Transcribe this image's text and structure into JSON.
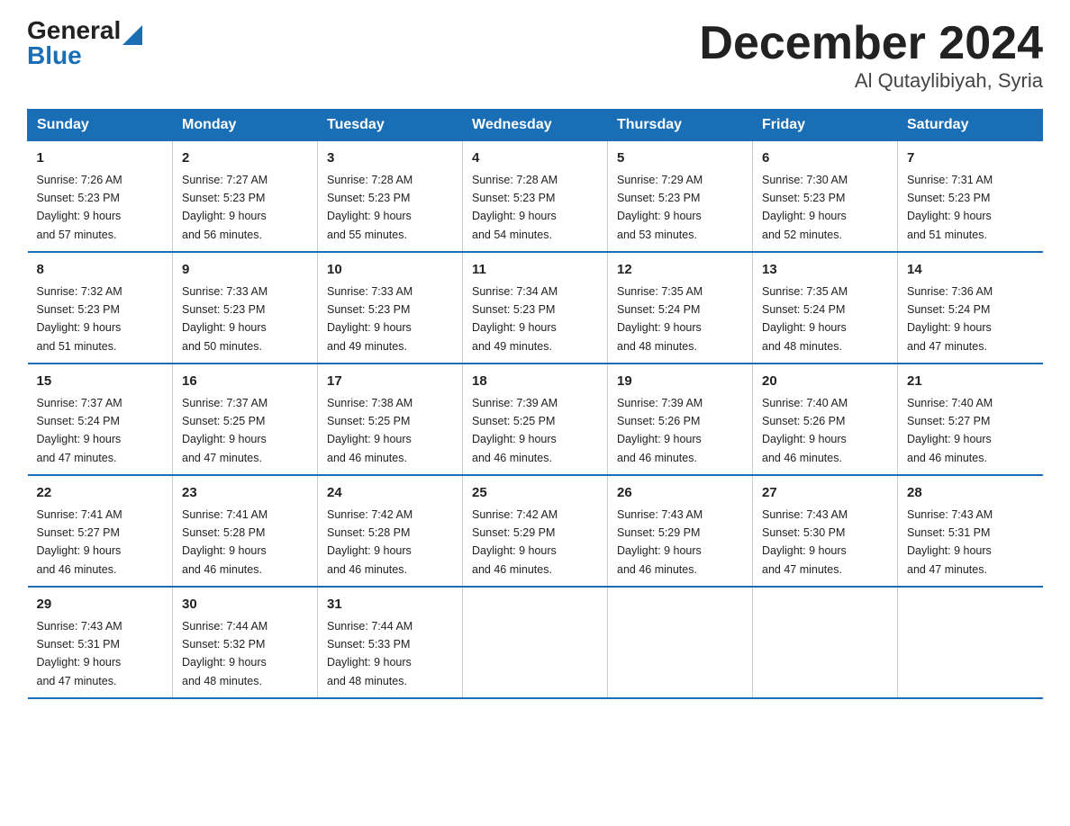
{
  "header": {
    "logo_general": "General",
    "logo_blue": "Blue",
    "month_title": "December 2024",
    "location": "Al Qutaylibiyah, Syria"
  },
  "days_of_week": [
    "Sunday",
    "Monday",
    "Tuesday",
    "Wednesday",
    "Thursday",
    "Friday",
    "Saturday"
  ],
  "weeks": [
    [
      {
        "day": "1",
        "sunrise": "7:26 AM",
        "sunset": "5:23 PM",
        "daylight": "9 hours and 57 minutes."
      },
      {
        "day": "2",
        "sunrise": "7:27 AM",
        "sunset": "5:23 PM",
        "daylight": "9 hours and 56 minutes."
      },
      {
        "day": "3",
        "sunrise": "7:28 AM",
        "sunset": "5:23 PM",
        "daylight": "9 hours and 55 minutes."
      },
      {
        "day": "4",
        "sunrise": "7:28 AM",
        "sunset": "5:23 PM",
        "daylight": "9 hours and 54 minutes."
      },
      {
        "day": "5",
        "sunrise": "7:29 AM",
        "sunset": "5:23 PM",
        "daylight": "9 hours and 53 minutes."
      },
      {
        "day": "6",
        "sunrise": "7:30 AM",
        "sunset": "5:23 PM",
        "daylight": "9 hours and 52 minutes."
      },
      {
        "day": "7",
        "sunrise": "7:31 AM",
        "sunset": "5:23 PM",
        "daylight": "9 hours and 51 minutes."
      }
    ],
    [
      {
        "day": "8",
        "sunrise": "7:32 AM",
        "sunset": "5:23 PM",
        "daylight": "9 hours and 51 minutes."
      },
      {
        "day": "9",
        "sunrise": "7:33 AM",
        "sunset": "5:23 PM",
        "daylight": "9 hours and 50 minutes."
      },
      {
        "day": "10",
        "sunrise": "7:33 AM",
        "sunset": "5:23 PM",
        "daylight": "9 hours and 49 minutes."
      },
      {
        "day": "11",
        "sunrise": "7:34 AM",
        "sunset": "5:23 PM",
        "daylight": "9 hours and 49 minutes."
      },
      {
        "day": "12",
        "sunrise": "7:35 AM",
        "sunset": "5:24 PM",
        "daylight": "9 hours and 48 minutes."
      },
      {
        "day": "13",
        "sunrise": "7:35 AM",
        "sunset": "5:24 PM",
        "daylight": "9 hours and 48 minutes."
      },
      {
        "day": "14",
        "sunrise": "7:36 AM",
        "sunset": "5:24 PM",
        "daylight": "9 hours and 47 minutes."
      }
    ],
    [
      {
        "day": "15",
        "sunrise": "7:37 AM",
        "sunset": "5:24 PM",
        "daylight": "9 hours and 47 minutes."
      },
      {
        "day": "16",
        "sunrise": "7:37 AM",
        "sunset": "5:25 PM",
        "daylight": "9 hours and 47 minutes."
      },
      {
        "day": "17",
        "sunrise": "7:38 AM",
        "sunset": "5:25 PM",
        "daylight": "9 hours and 46 minutes."
      },
      {
        "day": "18",
        "sunrise": "7:39 AM",
        "sunset": "5:25 PM",
        "daylight": "9 hours and 46 minutes."
      },
      {
        "day": "19",
        "sunrise": "7:39 AM",
        "sunset": "5:26 PM",
        "daylight": "9 hours and 46 minutes."
      },
      {
        "day": "20",
        "sunrise": "7:40 AM",
        "sunset": "5:26 PM",
        "daylight": "9 hours and 46 minutes."
      },
      {
        "day": "21",
        "sunrise": "7:40 AM",
        "sunset": "5:27 PM",
        "daylight": "9 hours and 46 minutes."
      }
    ],
    [
      {
        "day": "22",
        "sunrise": "7:41 AM",
        "sunset": "5:27 PM",
        "daylight": "9 hours and 46 minutes."
      },
      {
        "day": "23",
        "sunrise": "7:41 AM",
        "sunset": "5:28 PM",
        "daylight": "9 hours and 46 minutes."
      },
      {
        "day": "24",
        "sunrise": "7:42 AM",
        "sunset": "5:28 PM",
        "daylight": "9 hours and 46 minutes."
      },
      {
        "day": "25",
        "sunrise": "7:42 AM",
        "sunset": "5:29 PM",
        "daylight": "9 hours and 46 minutes."
      },
      {
        "day": "26",
        "sunrise": "7:43 AM",
        "sunset": "5:29 PM",
        "daylight": "9 hours and 46 minutes."
      },
      {
        "day": "27",
        "sunrise": "7:43 AM",
        "sunset": "5:30 PM",
        "daylight": "9 hours and 47 minutes."
      },
      {
        "day": "28",
        "sunrise": "7:43 AM",
        "sunset": "5:31 PM",
        "daylight": "9 hours and 47 minutes."
      }
    ],
    [
      {
        "day": "29",
        "sunrise": "7:43 AM",
        "sunset": "5:31 PM",
        "daylight": "9 hours and 47 minutes."
      },
      {
        "day": "30",
        "sunrise": "7:44 AM",
        "sunset": "5:32 PM",
        "daylight": "9 hours and 48 minutes."
      },
      {
        "day": "31",
        "sunrise": "7:44 AM",
        "sunset": "5:33 PM",
        "daylight": "9 hours and 48 minutes."
      },
      null,
      null,
      null,
      null
    ]
  ],
  "labels": {
    "sunrise": "Sunrise:",
    "sunset": "Sunset:",
    "daylight": "Daylight:"
  }
}
